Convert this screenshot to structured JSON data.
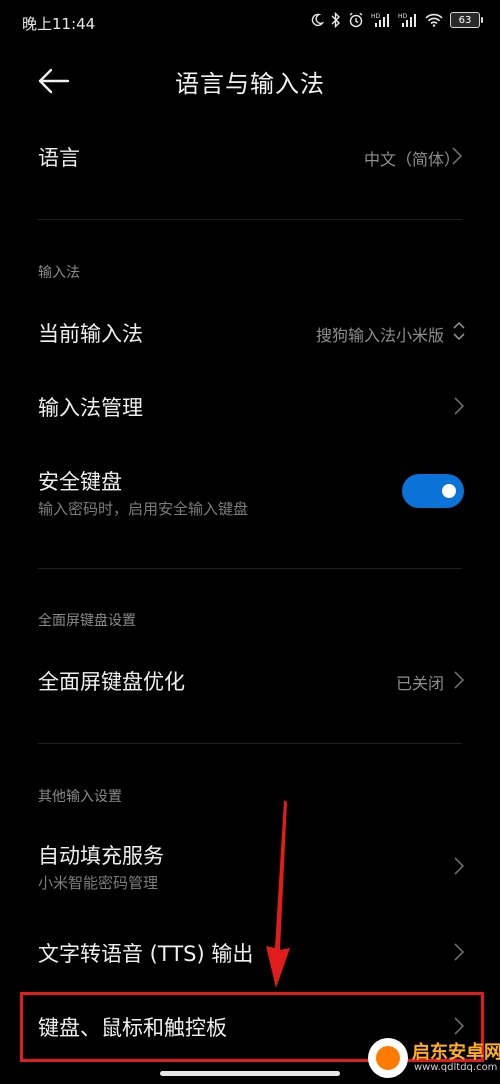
{
  "status_bar": {
    "time": "晚上11:44",
    "icons": [
      "moon-icon",
      "bluetooth-icon",
      "alarm-icon",
      "signal-hd-icon",
      "signal-hd-icon",
      "wifi-icon",
      "battery-icon"
    ],
    "battery_level": "63"
  },
  "header": {
    "title": "语言与输入法"
  },
  "language": {
    "label": "语言",
    "value": "中文（简体）"
  },
  "sections": {
    "input_method": "输入法",
    "fullscreen": "全面屏键盘设置",
    "other": "其他输入设置"
  },
  "rows": {
    "current_ime": {
      "label": "当前输入法",
      "value": "搜狗输入法小米版"
    },
    "ime_manage": {
      "label": "输入法管理"
    },
    "secure_keyboard": {
      "label": "安全键盘",
      "sub": "输入密码时，启用安全输入键盘",
      "enabled": true
    },
    "fullscreen_opt": {
      "label": "全面屏键盘优化",
      "value": "已关闭"
    },
    "autofill": {
      "label": "自动填充服务",
      "sub": "小米智能密码管理"
    },
    "tts": {
      "label": "文字转语音 (TTS) 输出"
    },
    "keyboard_mouse": {
      "label": "键盘、鼠标和触控板"
    }
  },
  "watermark": {
    "name": "启东安卓网",
    "url": "www.qdltdq.com"
  },
  "colors": {
    "toggle_on": "#0b73d8",
    "highlight": "#e01c1c",
    "watermark": "#ffb020"
  }
}
